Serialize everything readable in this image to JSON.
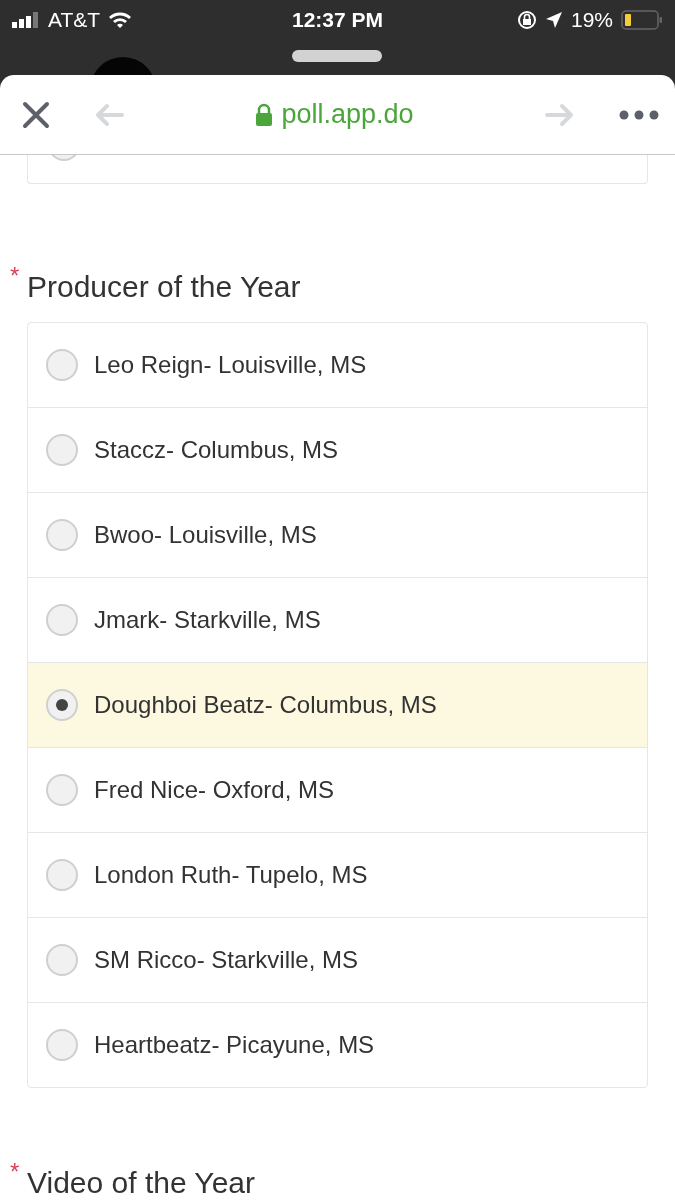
{
  "status_bar": {
    "carrier": "AT&T",
    "time": "12:37 PM",
    "battery": "19%"
  },
  "browser": {
    "url": "poll.app.do"
  },
  "previous_option": {
    "selected": false
  },
  "questions": [
    {
      "title": "Producer of the Year",
      "required": true,
      "required_mark": "*",
      "options": [
        {
          "label": "Leo Reign- Louisville, MS",
          "selected": false
        },
        {
          "label": "Staccz- Columbus, MS",
          "selected": false
        },
        {
          "label": "Bwoo- Louisville, MS",
          "selected": false
        },
        {
          "label": "Jmark- Starkville, MS",
          "selected": false
        },
        {
          "label": "Doughboi Beatz- Columbus, MS",
          "selected": true
        },
        {
          "label": "Fred Nice- Oxford, MS",
          "selected": false
        },
        {
          "label": "London Ruth- Tupelo, MS",
          "selected": false
        },
        {
          "label": "SM Ricco- Starkville, MS",
          "selected": false
        },
        {
          "label": "Heartbeatz- Picayune, MS",
          "selected": false
        }
      ]
    },
    {
      "title": "Video of the Year",
      "required": true,
      "required_mark": "*"
    }
  ]
}
